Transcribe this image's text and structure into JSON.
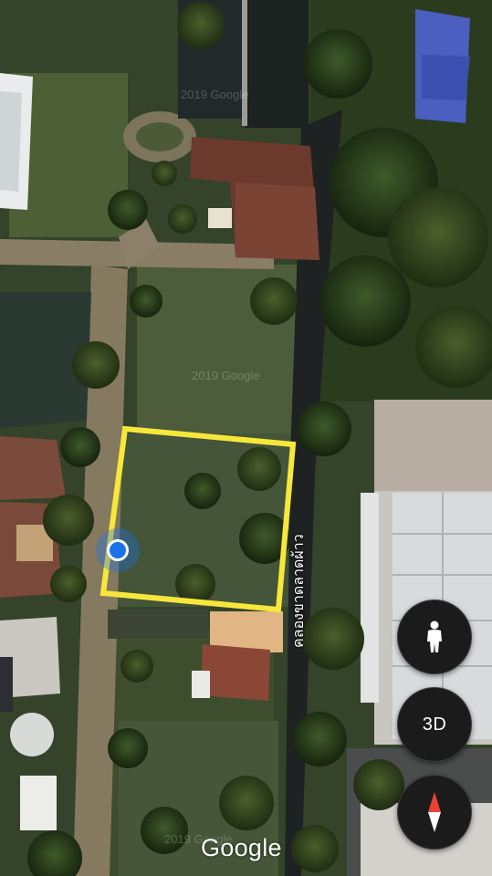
{
  "map": {
    "view": "satellite",
    "road_label": "คลองขาดลาดผ้าว",
    "watermarks": [
      "2019 Google",
      "2019 Google",
      "2019 Google"
    ],
    "attribution": "Google",
    "highlight_color": "#f7e73a",
    "location_color": "#1a73e8"
  },
  "controls": {
    "street_view_icon": "person-icon",
    "three_d_label": "3D",
    "compass_icon": "compass-icon"
  }
}
